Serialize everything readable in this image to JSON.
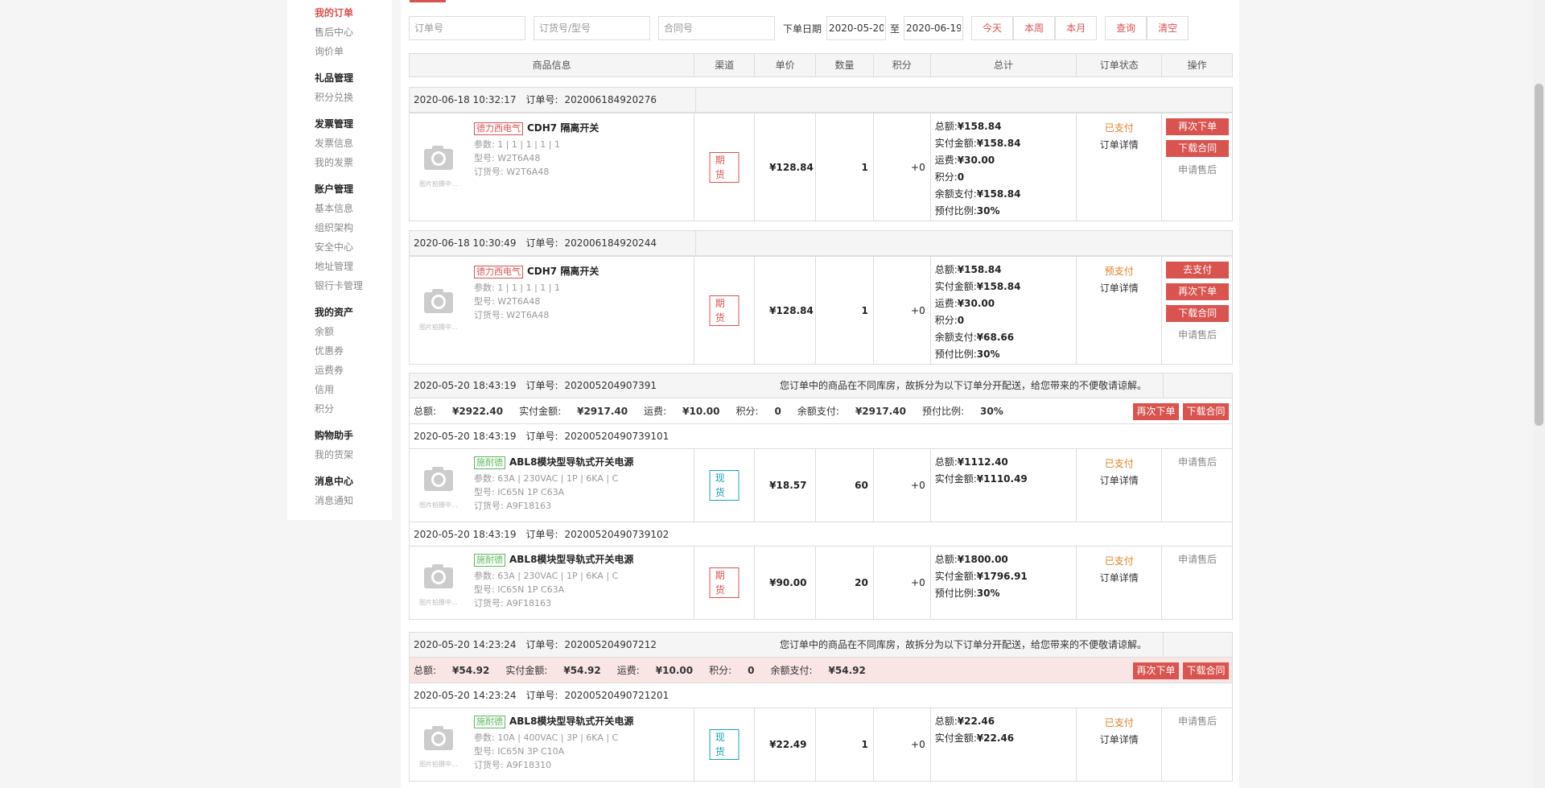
{
  "sidebar": {
    "groups": [
      {
        "head": "",
        "items": [
          "我的订单",
          "售后中心",
          "询价单"
        ]
      },
      {
        "head": "礼品管理",
        "items": [
          "积分兑换"
        ]
      },
      {
        "head": "发票管理",
        "items": [
          "发票信息",
          "我的发票"
        ]
      },
      {
        "head": "账户管理",
        "items": [
          "基本信息",
          "组织架构",
          "安全中心",
          "地址管理",
          "银行卡管理"
        ]
      },
      {
        "head": "我的资产",
        "items": [
          "余额",
          "优惠券",
          "运费券",
          "信用",
          "积分"
        ]
      },
      {
        "head": "购物助手",
        "items": [
          "我的货架"
        ]
      },
      {
        "head": "消息中心",
        "items": [
          "消息通知"
        ]
      }
    ]
  },
  "filter": {
    "order_no_placeholder": "订单号",
    "model_placeholder": "订货号/型号",
    "contract_placeholder": "合同号",
    "date_label": "下单日期",
    "date_from": "2020-05-20",
    "to_label": "至",
    "date_to": "2020-06-19",
    "today": "今天",
    "week": "本周",
    "month": "本月",
    "query": "查询",
    "clear": "清空"
  },
  "table_header": [
    "商品信息",
    "渠道",
    "单价",
    "数量",
    "积分",
    "总计",
    "订单状态",
    "操作"
  ],
  "labels": {
    "order_no": "订单号:",
    "params": "参数:",
    "model": "型号:",
    "sku": "订货号:",
    "total": "总额:",
    "paid_amount": "实付金额:",
    "freight": "运费:",
    "points": "积分:",
    "balance": "余额支付:",
    "prepay_ratio": "预付比例:",
    "order_detail": "订单详情",
    "reorder": "再次下单",
    "download_contract": "下载合同",
    "go_pay": "去支付",
    "after_sale": "申请售后",
    "split_note": "您订单中的商品在不同库房，故拆分为以下订单分开配送，给您带来的不便敬请谅解。",
    "thumb_caption": "图片拍摄中..."
  },
  "orders": [
    {
      "time": "2020-06-18 10:32:17",
      "no": "202006184920276",
      "brand": "德力西电气",
      "brand_color": "red",
      "name": "CDH7 隔离开关",
      "params": "1 | 1 | 1 | 1 | 1",
      "model": "W2T6A48",
      "sku": "W2T6A48",
      "channel": "期货",
      "price": "¥128.84",
      "qty": "1",
      "pts": "+0",
      "total": "¥158.84",
      "paid": "¥158.84",
      "freight": "¥30.00",
      "points": "0",
      "balance": "¥158.84",
      "ratio": "30%",
      "status": "已支付"
    },
    {
      "time": "2020-06-18 10:30:49",
      "no": "202006184920244",
      "brand": "德力西电气",
      "brand_color": "red",
      "name": "CDH7 隔离开关",
      "params": "1 | 1 | 1 | 1 | 1",
      "model": "W2T6A48",
      "sku": "W2T6A48",
      "channel": "期货",
      "price": "¥128.84",
      "qty": "1",
      "pts": "+0",
      "total": "¥158.84",
      "paid": "¥158.84",
      "freight": "¥30.00",
      "points": "0",
      "balance": "¥68.66",
      "ratio": "30%",
      "status": "预支付"
    }
  ],
  "split_orders": [
    {
      "time": "2020-05-20 18:43:19",
      "no": "202005204907391",
      "sum": {
        "total": "¥2922.40",
        "paid": "¥2917.40",
        "freight": "¥10.00",
        "points": "0",
        "balance": "¥2917.40",
        "ratio": "30%"
      },
      "subs": [
        {
          "time": "2020-05-20 18:43:19",
          "no": "20200520490739101",
          "brand": "施耐德",
          "name": "ABL8模块型导轨式开关电源",
          "params": "63A | 230VAC | 1P | 6KA | C",
          "model": "IC65N 1P C63A",
          "sku": "A9F18163",
          "channel": "现货",
          "price": "¥18.57",
          "qty": "60",
          "pts": "+0",
          "total": "¥1112.40",
          "paid": "¥1110.49",
          "status": "已支付"
        },
        {
          "time": "2020-05-20 18:43:19",
          "no": "20200520490739102",
          "brand": "施耐德",
          "name": "ABL8模块型导轨式开关电源",
          "params": "63A | 230VAC | 1P | 6KA | C",
          "model": "IC65N 1P C63A",
          "sku": "A9F18163",
          "channel": "期货",
          "price": "¥90.00",
          "qty": "20",
          "pts": "+0",
          "total": "¥1800.00",
          "paid": "¥1796.91",
          "ratio": "30%",
          "status": "已支付"
        }
      ]
    },
    {
      "time": "2020-05-20 14:23:24",
      "no": "202005204907212",
      "sum": {
        "total": "¥54.92",
        "paid": "¥54.92",
        "freight": "¥10.00",
        "points": "0",
        "balance": "¥54.92"
      },
      "subs": [
        {
          "time": "2020-05-20 14:23:24",
          "no": "20200520490721201",
          "brand": "施耐德",
          "name": "ABL8模块型导轨式开关电源",
          "params": "10A | 400VAC | 3P | 6KA | C",
          "model": "IC65N 3P C10A",
          "sku": "A9F18310",
          "channel": "现货",
          "price": "¥22.49",
          "qty": "1",
          "pts": "+0",
          "total": "¥22.46",
          "paid": "¥22.46",
          "status": "已支付"
        }
      ]
    }
  ]
}
